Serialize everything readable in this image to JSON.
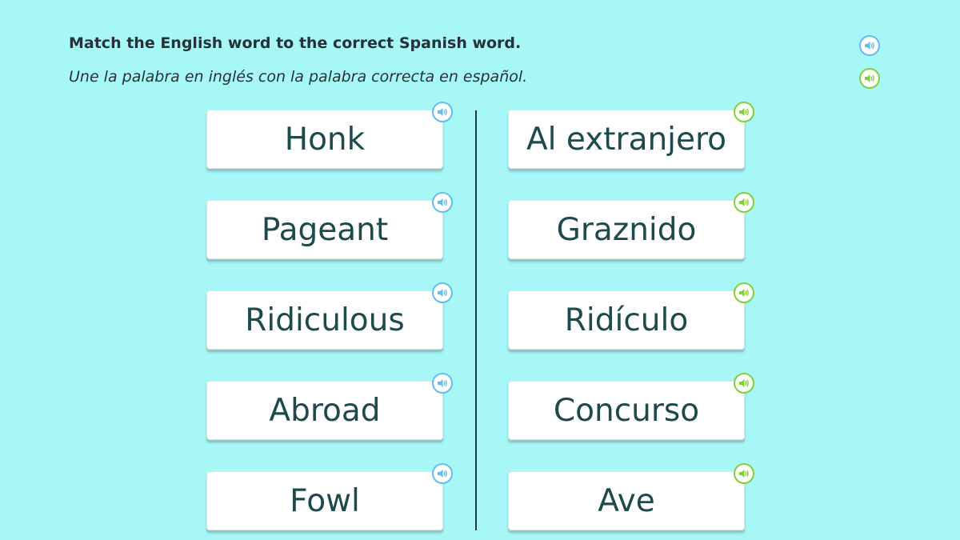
{
  "instructions": {
    "english": "Match the English word to the correct Spanish word.",
    "spanish": "Une la palabra en inglés con la palabra correcta en español."
  },
  "colors": {
    "background": "#a6f7f5",
    "english_audio": "#62bdf0",
    "spanish_audio": "#82d037",
    "card_text": "#1e4a4c"
  },
  "icons": {
    "audio": "speaker-icon"
  },
  "english_words": [
    {
      "label": "Honk"
    },
    {
      "label": "Pageant"
    },
    {
      "label": "Ridiculous"
    },
    {
      "label": "Abroad"
    },
    {
      "label": "Fowl"
    }
  ],
  "spanish_words": [
    {
      "label": "Al extranjero"
    },
    {
      "label": "Graznido"
    },
    {
      "label": "Ridículo"
    },
    {
      "label": "Concurso"
    },
    {
      "label": "Ave"
    }
  ]
}
